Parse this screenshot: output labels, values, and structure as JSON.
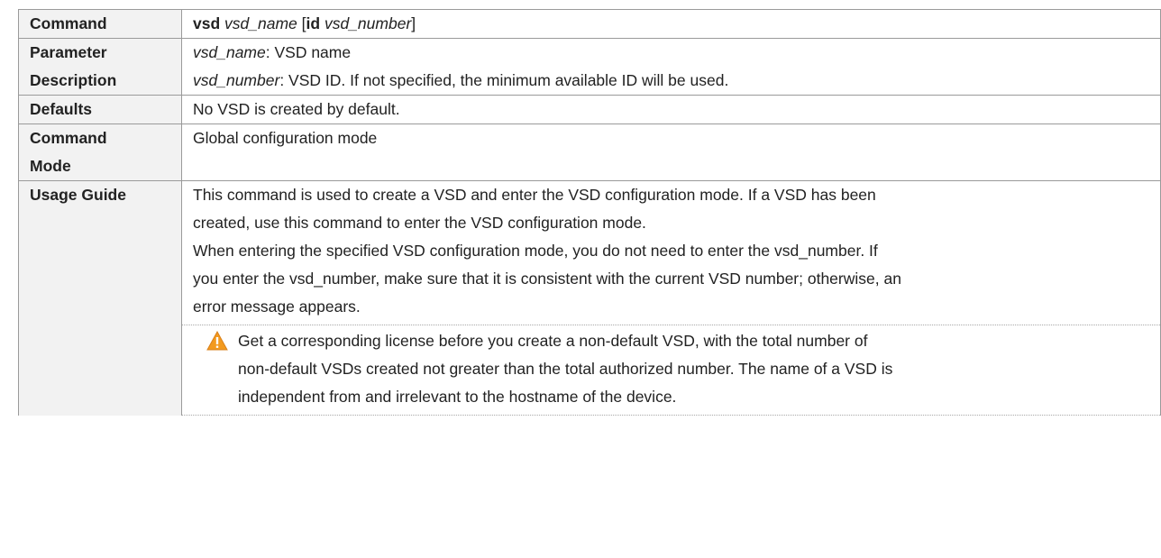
{
  "rows": {
    "command": {
      "label": "Command",
      "kw1": "vsd",
      "arg1": "vsd_name",
      "bracket_open": "[",
      "kw2": "id",
      "arg2": "vsd_number",
      "bracket_close": "]"
    },
    "parameter": {
      "label1": "Parameter",
      "label2": "Description",
      "p1_name": "vsd_name",
      "p1_desc": ": VSD name",
      "p2_name": "vsd_number",
      "p2_desc": ": VSD ID. If not specified, the minimum available ID will be used."
    },
    "defaults": {
      "label": "Defaults",
      "text": "No VSD is created by default."
    },
    "mode": {
      "label1": "Command",
      "label2": "Mode",
      "text": "Global configuration mode"
    },
    "usage": {
      "label": "Usage Guide",
      "p1_l1": "This command is used to create a VSD and enter the VSD configuration mode. If a VSD has been",
      "p1_l2": "created, use this command to enter the VSD configuration mode.",
      "p2_l1": "When entering the specified VSD configuration mode, you do not need to enter the vsd_number. If",
      "p2_l2": "you enter the vsd_number, make sure that it is consistent with the current VSD number; otherwise, an",
      "p2_l3": "error message appears.",
      "warn_l1": "Get a corresponding license before you create a non-default VSD, with the total number of",
      "warn_l2": "non-default VSDs created not greater than the total authorized number. The name of a VSD is",
      "warn_l3": "independent from and irrelevant to the hostname of the device.",
      "warn_icon": "warning-triangle-icon"
    }
  },
  "colors": {
    "label_bg": "#f2f2f2",
    "border": "#9a9a9a",
    "warning": "#f39a1e"
  }
}
